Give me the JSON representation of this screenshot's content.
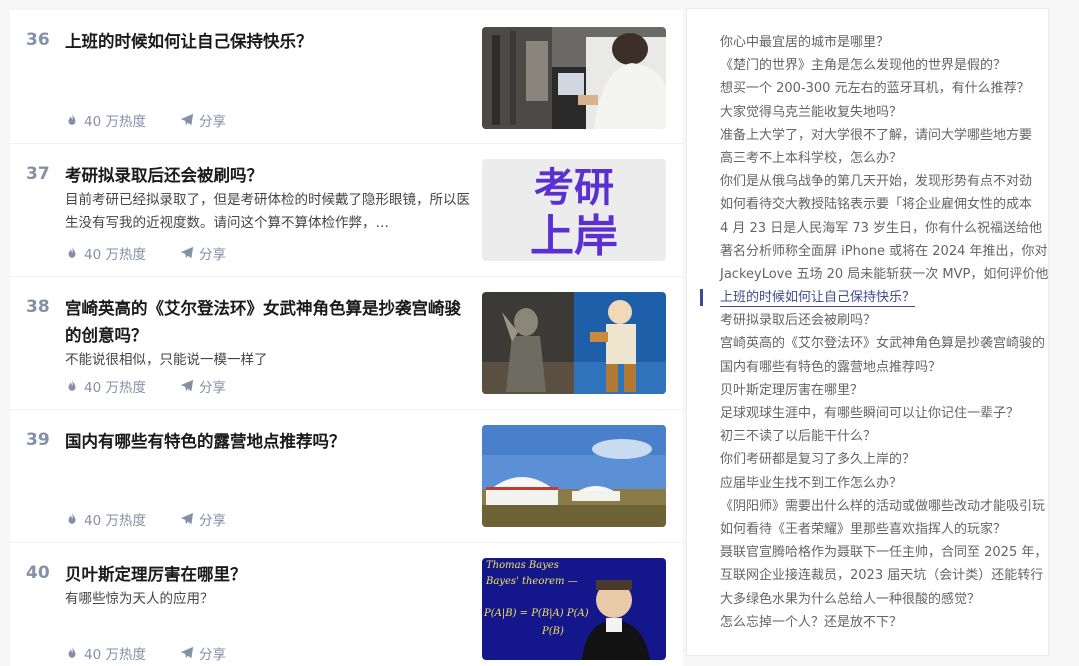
{
  "feed": {
    "items": [
      {
        "rank": "36",
        "title": "上班的时候如何让自己保持快乐？",
        "excerpt": "",
        "heat": "40 万热度",
        "share": "分享"
      },
      {
        "rank": "37",
        "title": "考研拟录取后还会被刷吗？",
        "excerpt": "目前考研已经拟录取了，但是考研体检的时候戴了隐形眼镜，所以医生没有写我的近视度数。请问这个算不算体检作弊，…",
        "heat": "40 万热度",
        "share": "分享",
        "thumb_text": [
          "考研",
          "上岸"
        ]
      },
      {
        "rank": "38",
        "title": "宫崎英高的《艾尔登法环》女武神角色算是抄袭宫崎骏的创意吗？",
        "excerpt": "不能说很相似，只能说一模一样了",
        "heat": "40 万热度",
        "share": "分享"
      },
      {
        "rank": "39",
        "title": "国内有哪些有特色的露营地点推荐吗？",
        "excerpt": "",
        "heat": "40 万热度",
        "share": "分享"
      },
      {
        "rank": "40",
        "title": "贝叶斯定理厉害在哪里？",
        "excerpt": "有哪些惊为天人的应用？",
        "heat": "40 万热度",
        "share": "分享",
        "thumb_text": [
          "Thomas Bayes",
          "Bayes' theorem —",
          "P(A|B) = P(B|A) P(A)",
          "P(B)"
        ]
      }
    ]
  },
  "sidebar": {
    "items": [
      {
        "label": "你心中最宜居的城市是哪里？",
        "active": false
      },
      {
        "label": "《楚门的世界》主角是怎么发现他的世界是假的？",
        "active": false
      },
      {
        "label": "想买一个 200-300 元左右的蓝牙耳机，有什么推荐？",
        "active": false
      },
      {
        "label": "大家觉得乌克兰能收复失地吗？",
        "active": false
      },
      {
        "label": "准备上大学了，对大学很不了解，请问大学哪些地方要",
        "active": false
      },
      {
        "label": "高三考不上本科学校，怎么办？",
        "active": false
      },
      {
        "label": "你们是从俄乌战争的第几天开始，发现形势有点不对劲",
        "active": false
      },
      {
        "label": "如何看待交大教授陆铭表示要「将企业雇佣女性的成本",
        "active": false
      },
      {
        "label": "4 月 23 日是人民海军 73 岁生日，你有什么祝福送给他",
        "active": false
      },
      {
        "label": "著名分析师称全面屏 iPhone 或将在 2024 年推出，你对",
        "active": false
      },
      {
        "label": "JackeyLove 五场 20 局未能斩获一次 MVP，如何评价他",
        "active": false
      },
      {
        "label": "上班的时候如何让自己保持快乐？",
        "active": true
      },
      {
        "label": "考研拟录取后还会被刷吗？",
        "active": false
      },
      {
        "label": "宫崎英高的《艾尔登法环》女武神角色算是抄袭宫崎骏的",
        "active": false
      },
      {
        "label": "国内有哪些有特色的露营地点推荐吗？",
        "active": false
      },
      {
        "label": "贝叶斯定理厉害在哪里？",
        "active": false
      },
      {
        "label": "足球观球生涯中，有哪些瞬间可以让你记住一辈子？",
        "active": false
      },
      {
        "label": "初三不读了以后能干什么？",
        "active": false
      },
      {
        "label": "你们考研都是复习了多久上岸的？",
        "active": false
      },
      {
        "label": "应届毕业生找不到工作怎么办？",
        "active": false
      },
      {
        "label": "《阴阳师》需要出什么样的活动或做哪些改动才能吸引玩",
        "active": false
      },
      {
        "label": "如何看待《王者荣耀》里那些喜欢指挥人的玩家？",
        "active": false
      },
      {
        "label": "聂联官宣腾哈格作为聂联下一任主帅，合同至 2025 年，",
        "active": false
      },
      {
        "label": "互联网企业接连裁员，2023 届天坑（会计类）还能转行",
        "active": false
      },
      {
        "label": "大多绿色水果为什么总给人一种很酸的感觉？",
        "active": false
      },
      {
        "label": "怎么忘掉一个人？还是放不下？",
        "active": false
      }
    ]
  },
  "colors": {
    "accent": "#3f4b8a",
    "meta": "#8590a6",
    "thumb_text": "#5b2fd0"
  }
}
